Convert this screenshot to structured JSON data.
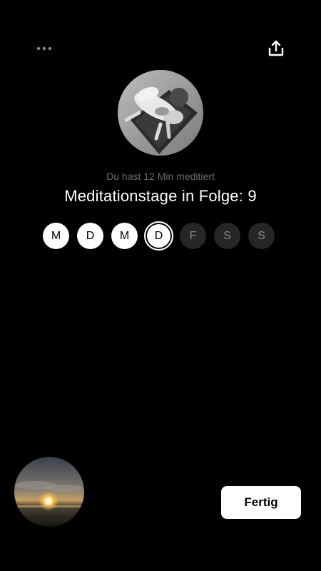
{
  "header": {
    "more_icon": "more-horizontal-icon",
    "share_icon": "share-upload-icon"
  },
  "session": {
    "summary": "Du hast 12 Min meditiert",
    "streak_title": "Meditationstage in Folge: 9"
  },
  "week": {
    "days": [
      {
        "label": "M",
        "state": "done"
      },
      {
        "label": "D",
        "state": "done"
      },
      {
        "label": "M",
        "state": "done"
      },
      {
        "label": "D",
        "state": "today"
      },
      {
        "label": "F",
        "state": "future"
      },
      {
        "label": "S",
        "state": "future"
      },
      {
        "label": "S",
        "state": "future"
      }
    ]
  },
  "actions": {
    "done_label": "Fertig"
  },
  "colors": {
    "background": "#000000",
    "subtitle": "#6b6b6b",
    "future_day_bg": "#262626",
    "button_bg": "#ffffff"
  }
}
